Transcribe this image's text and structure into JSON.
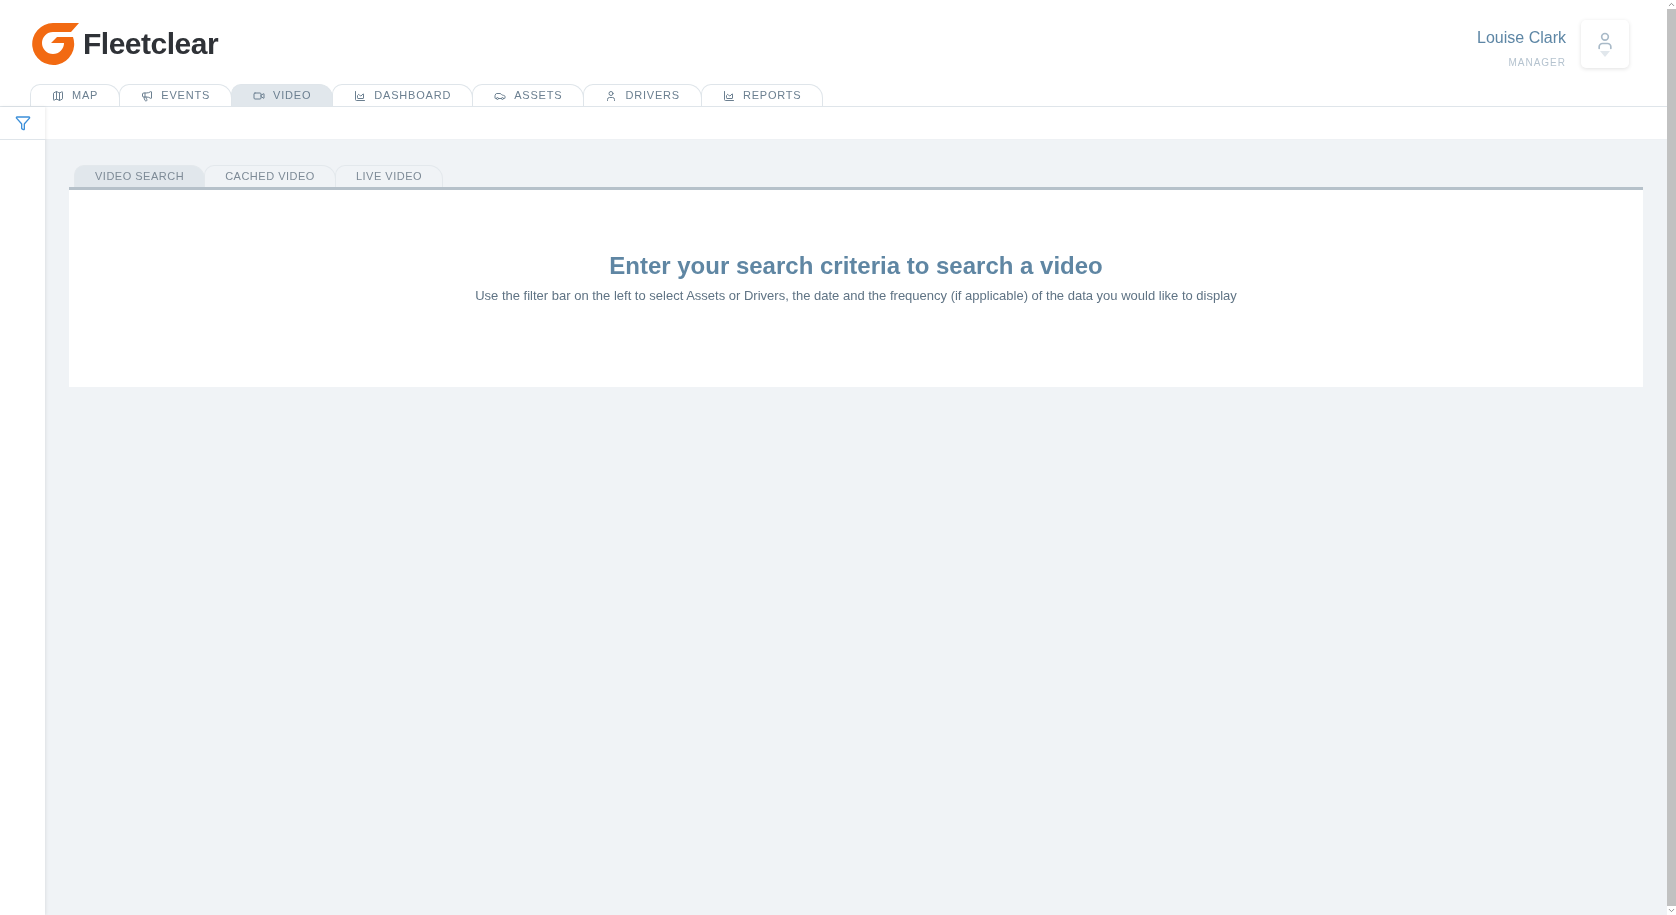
{
  "brand": {
    "name": "Fleetclear"
  },
  "user": {
    "name": "Louise Clark",
    "role": "MANAGER"
  },
  "nav_tabs": [
    {
      "label": "MAP",
      "kind": "map",
      "selected": false
    },
    {
      "label": "EVENTS",
      "kind": "megaphone",
      "selected": false
    },
    {
      "label": "VIDEO",
      "kind": "video",
      "selected": true
    },
    {
      "label": "DASHBOARD",
      "kind": "chart",
      "selected": false
    },
    {
      "label": "ASSETS",
      "kind": "car",
      "selected": false
    },
    {
      "label": "DRIVERS",
      "kind": "user",
      "selected": false
    },
    {
      "label": "REPORTS",
      "kind": "chart",
      "selected": false
    }
  ],
  "video_tabs": [
    {
      "label": "VIDEO SEARCH",
      "selected": true
    },
    {
      "label": "CACHED VIDEO",
      "selected": false
    },
    {
      "label": "LIVE VIDEO",
      "selected": false
    }
  ],
  "empty_state": {
    "title": "Enter your search criteria to search a video",
    "text": "Use the filter bar on the left to select Assets or Drivers, the date and the frequency (if applicable) of the data you would like to display"
  }
}
